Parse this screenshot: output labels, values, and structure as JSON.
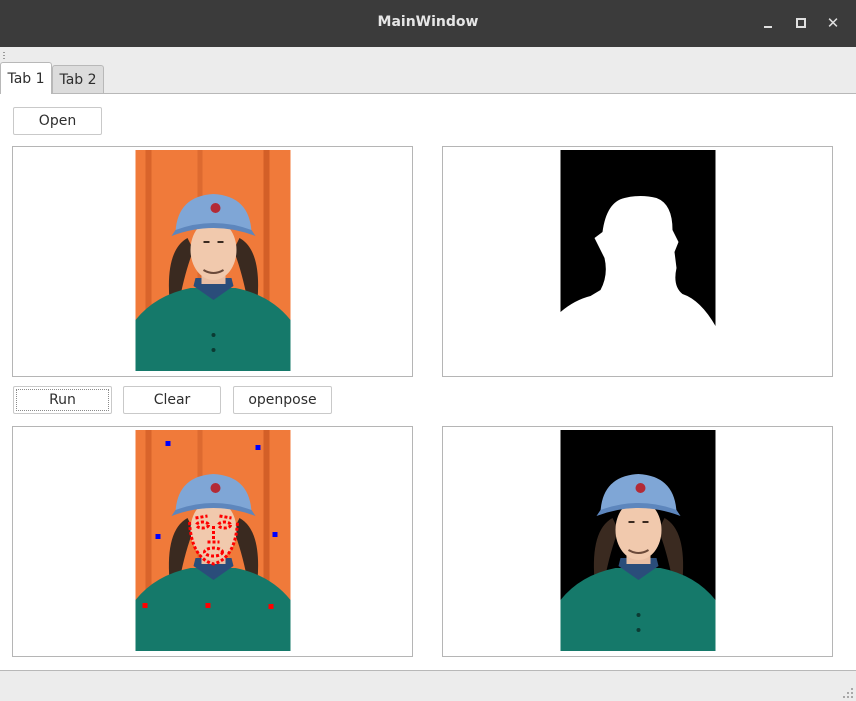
{
  "window": {
    "title": "MainWindow"
  },
  "tabs": [
    {
      "label": "Tab 1"
    },
    {
      "label": "Tab 2"
    }
  ],
  "buttons": {
    "open": "Open",
    "run": "Run",
    "clear": "Clear",
    "openpose": "openpose"
  },
  "views": {
    "original": "portrait-photo",
    "mask": "binary-mask-silhouette",
    "keypoints": "portrait-with-pose-and-face-keypoints",
    "cutout": "portrait-background-removed"
  },
  "colors": {
    "titlebar": "#3b3b3b",
    "photo_background": "#f07a3a",
    "cap": "#7fa6d6",
    "jacket": "#15796a",
    "keypoint_face": "#ff0000",
    "keypoint_body": "#0000ff"
  }
}
